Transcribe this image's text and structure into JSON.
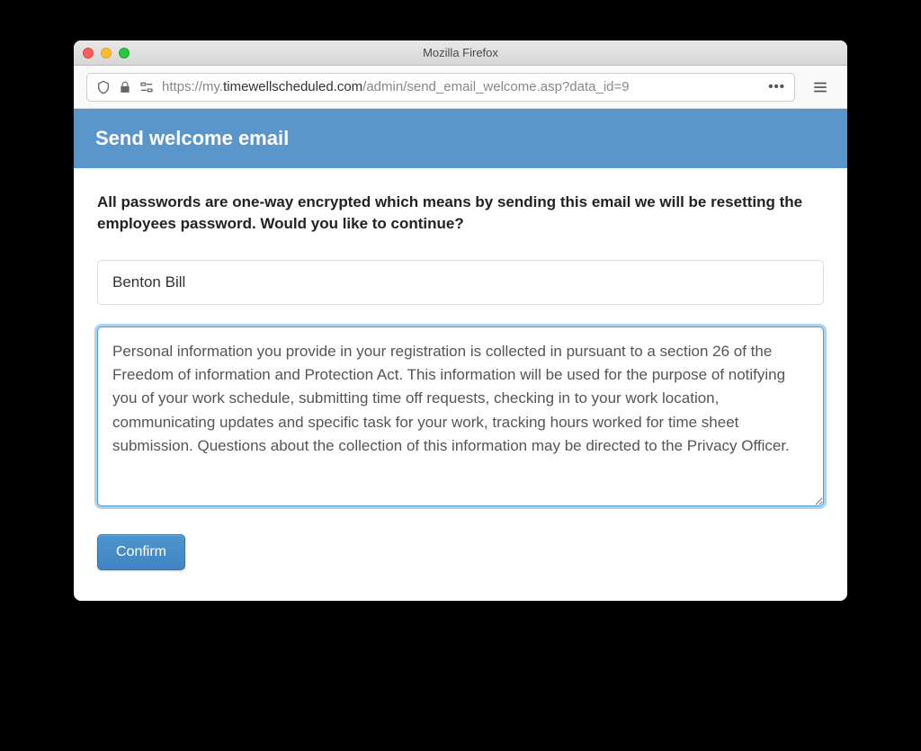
{
  "window": {
    "title": "Mozilla Firefox"
  },
  "address": {
    "protocol": "https://",
    "subdomain": "my.",
    "domain": "timewellscheduled.com",
    "path": "/admin/send_email_welcome.asp?data_id=9"
  },
  "page": {
    "header": "Send welcome email",
    "warning": "All passwords are one-way encrypted which means by sending this email we will be resetting the employees password. Would you like to continue?",
    "employee_name": "Benton Bill",
    "message": "Personal information you provide in your registration is collected in pursuant to a section 26 of the Freedom of information and Protection Act. This information will be used for the purpose of notifying you of your work schedule, submitting time off requests, checking in to your work location, communicating updates and specific task for your work, tracking hours worked for time sheet submission. Questions about the collection of this information may be directed to the Privacy Officer.",
    "confirm_label": "Confirm"
  }
}
